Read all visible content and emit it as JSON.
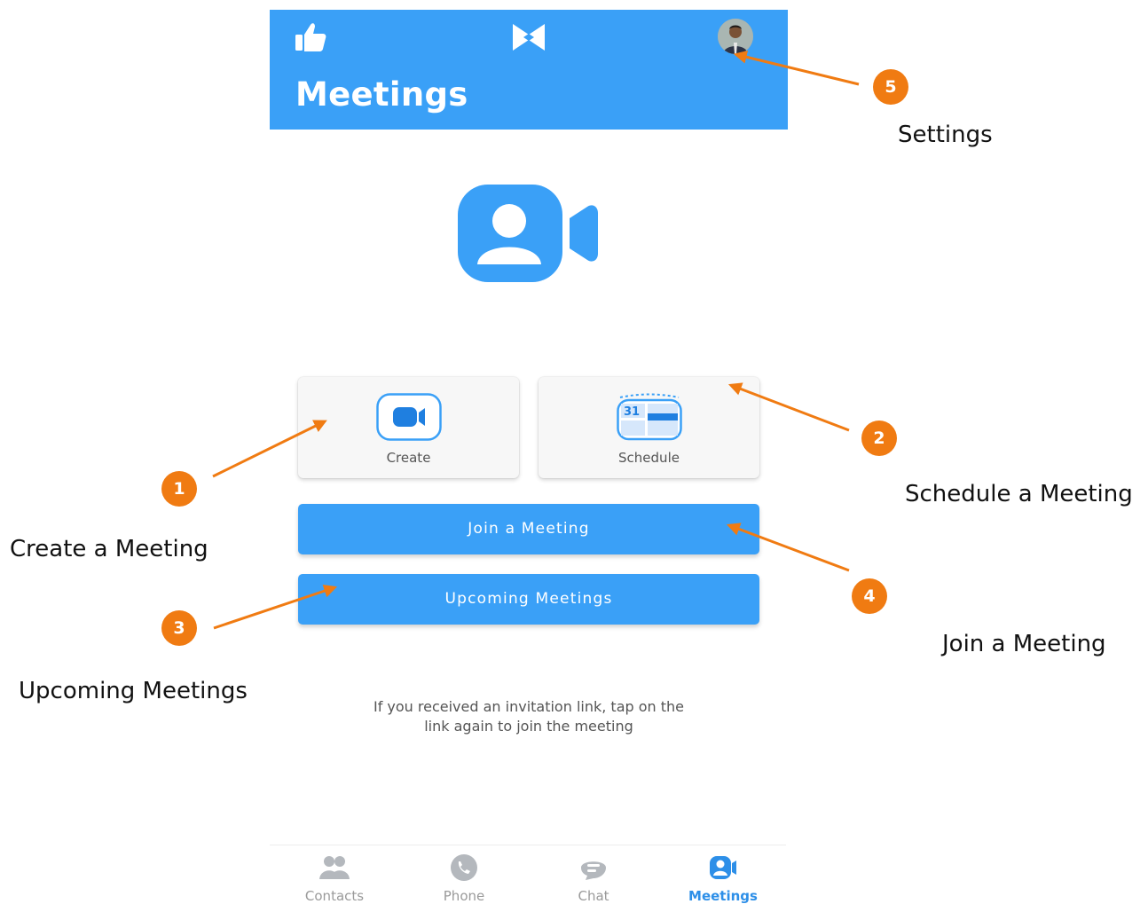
{
  "header": {
    "title": "Meetings"
  },
  "cards": {
    "create_label": "Create",
    "schedule_label": "Schedule",
    "calendar_day": "31"
  },
  "buttons": {
    "join_label": "Join a Meeting",
    "upcoming_label": "Upcoming Meetings"
  },
  "info": {
    "line1": "If you received an invitation link, tap on the",
    "line2": "link again to join the meeting"
  },
  "tabs": [
    {
      "label": "Contacts",
      "icon": "contacts-icon",
      "active": false
    },
    {
      "label": "Phone",
      "icon": "phone-icon",
      "active": false
    },
    {
      "label": "Chat",
      "icon": "chat-icon",
      "active": false
    },
    {
      "label": "Meetings",
      "icon": "meetings-icon",
      "active": true
    }
  ],
  "annotations": [
    {
      "number": "1",
      "text": "Create a Meeting"
    },
    {
      "number": "2",
      "text": "Schedule a Meeting"
    },
    {
      "number": "3",
      "text": "Upcoming Meetings"
    },
    {
      "number": "4",
      "text": "Join a Meeting"
    },
    {
      "number": "5",
      "text": "Settings"
    }
  ],
  "colors": {
    "primary": "#3aa0f7",
    "accent_orange": "#f07b12",
    "active_tab": "#2d8fe8"
  }
}
